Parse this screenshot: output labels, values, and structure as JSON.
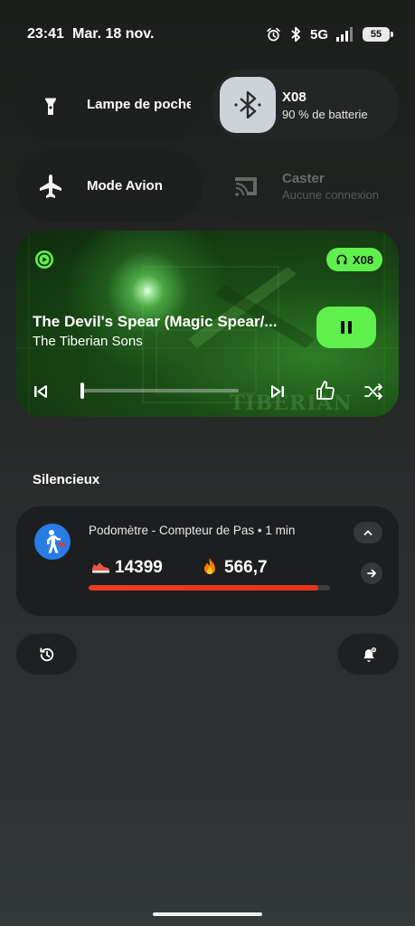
{
  "status_bar": {
    "time": "23:41",
    "date": "Mar. 18 nov.",
    "network": "5G",
    "battery": "55",
    "icons": [
      "alarm-icon",
      "bluetooth-icon",
      "signal-icon",
      "battery-icon"
    ]
  },
  "quick_settings": {
    "flashlight": {
      "label": "Lampe de poche",
      "icon": "flashlight-icon",
      "active": false
    },
    "bluetooth": {
      "label": "X08",
      "sublabel": "90 % de batterie",
      "icon": "bluetooth-icon",
      "active": true
    },
    "airplane": {
      "label": "Mode Avion",
      "icon": "airplane-icon",
      "active": false
    },
    "cast": {
      "label": "Caster",
      "sublabel": "Aucune connexion",
      "icon": "cast-icon",
      "enabled": false
    }
  },
  "media": {
    "title": "The Devil's Spear (Magic Spear/...",
    "artist": "The Tiberian Sons",
    "output_device": "X08",
    "progress": 0.0,
    "album_text": "TIBERIAN",
    "accent_color": "#5ff04e",
    "controls": [
      "skip-previous-icon",
      "skip-next-icon",
      "thumbs-up-icon",
      "shuffle-icon"
    ],
    "state": "playing"
  },
  "section": {
    "title": "Silencieux"
  },
  "notification": {
    "header": "Podomètre - Compteur de Pas • 1 min",
    "steps": "14399",
    "calories": "566,7",
    "progress": 0.95,
    "bar_color": "#ef3b1e"
  },
  "bottom_buttons": [
    "history-icon",
    "notification-settings-icon"
  ]
}
